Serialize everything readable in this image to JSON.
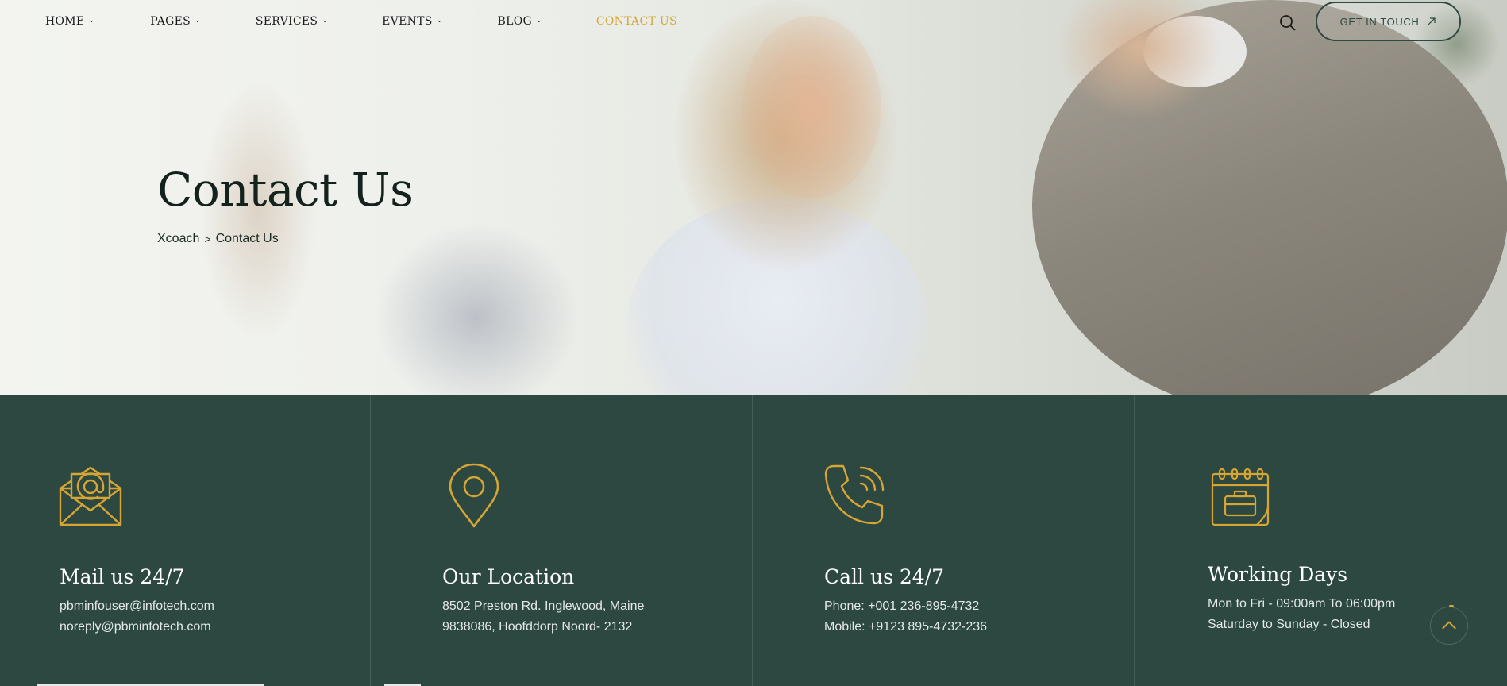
{
  "nav": {
    "items": [
      {
        "label": "HOME",
        "has_dropdown": true
      },
      {
        "label": "PAGES",
        "has_dropdown": true
      },
      {
        "label": "SERVICES",
        "has_dropdown": true
      },
      {
        "label": "EVENTS",
        "has_dropdown": true
      },
      {
        "label": "BLOG",
        "has_dropdown": true
      },
      {
        "label": "CONTACT US",
        "has_dropdown": false,
        "active": true
      }
    ],
    "search_icon": "search-icon",
    "cta_label": "GET IN TOUCH",
    "cta_icon": "arrow-up-right-icon"
  },
  "hero": {
    "title": "Contact Us",
    "breadcrumb": {
      "home": "Xcoach",
      "separator": ">",
      "current": "Contact Us"
    }
  },
  "info": {
    "columns": [
      {
        "icon": "envelope-at-icon",
        "title": "Mail us 24/7",
        "lines": [
          "pbminfouser@infotech.com",
          "noreply@pbminfotech.com"
        ]
      },
      {
        "icon": "map-pin-icon",
        "title": "Our Location",
        "lines": [
          "8502 Preston Rd. Inglewood, Maine",
          "9838086, Hoofddorp Noord- 2132"
        ]
      },
      {
        "icon": "phone-icon",
        "title": "Call us 24/7",
        "lines": [
          "Phone: +001 236-895-4732",
          "Mobile: +9123 895-4732-236"
        ]
      },
      {
        "icon": "calendar-briefcase-icon",
        "title": "Working Days",
        "lines": [
          "Mon to Fri - 09:00am To 06:00pm",
          "Saturday to Sunday - Closed"
        ]
      }
    ]
  },
  "colors": {
    "accent": "#d6a534",
    "band_bg": "#2c4841",
    "title_dark": "#13221d"
  },
  "scroll_top_icon": "chevron-up-icon"
}
